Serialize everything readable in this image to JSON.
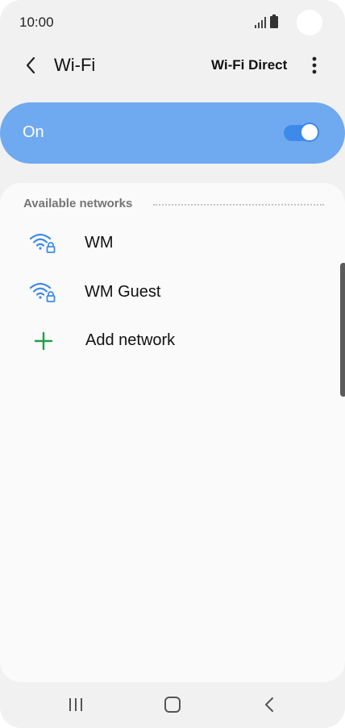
{
  "status_bar": {
    "time": "10:00"
  },
  "header": {
    "title": "Wi-Fi",
    "back_icon": "chevron-left-icon",
    "wifi_direct_label": "Wi-Fi Direct",
    "more_icon": "more-vertical-icon"
  },
  "toggle": {
    "label": "On",
    "state": true,
    "card_color": "#6fa9f0",
    "switch_color": "#3e8ae8"
  },
  "networks": {
    "section_title": "Available networks",
    "items": [
      {
        "name": "WM",
        "icon": "wifi-lock-icon",
        "secured": true
      },
      {
        "name": "WM Guest",
        "icon": "wifi-lock-icon",
        "secured": true
      }
    ],
    "add_label": "Add network",
    "add_icon_color": "#1aa14a",
    "wifi_icon_color": "#3e8ae8"
  },
  "nav_bar": {
    "recent_icon": "recent-apps-icon",
    "home_icon": "home-icon",
    "back_icon": "back-icon"
  }
}
